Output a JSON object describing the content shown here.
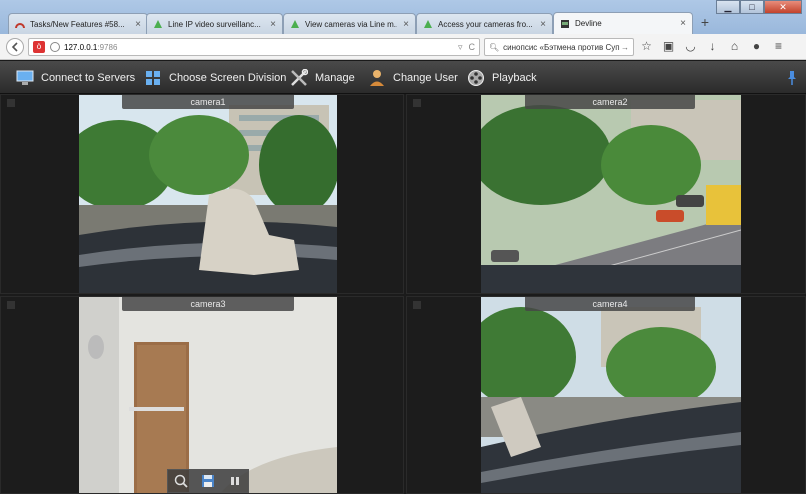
{
  "browser": {
    "tabs": [
      {
        "title": "Tasks/New Features #58...",
        "icon": "redmine-icon",
        "active": false
      },
      {
        "title": "Line IP video surveillanc...",
        "icon": "line-icon",
        "active": false
      },
      {
        "title": "View cameras via Line m...",
        "icon": "line-icon",
        "active": false
      },
      {
        "title": "Access your cameras fro...",
        "icon": "line-icon",
        "active": false
      },
      {
        "title": "Devline",
        "icon": "devline-icon",
        "active": true
      }
    ],
    "tab_close": "×",
    "new_tab": "+",
    "window_buttons": {
      "minimize": "▁",
      "maximize": "□",
      "close": "✕"
    },
    "url_host": "127.0.0.1",
    "url_port": ":9786",
    "search_text": "синопсис «Бэтмена против Суп"
  },
  "toolbar": {
    "items": [
      {
        "label": "Connect to Servers",
        "icon": "monitor-icon"
      },
      {
        "label": "Choose Screen Division",
        "icon": "grid-icon"
      },
      {
        "label": "Manage",
        "icon": "tools-icon"
      },
      {
        "label": "Change User",
        "icon": "user-icon"
      },
      {
        "label": "Playback",
        "icon": "film-reel-icon"
      }
    ]
  },
  "cameras": [
    {
      "label": "camera1"
    },
    {
      "label": "camera2"
    },
    {
      "label": "camera3"
    },
    {
      "label": "camera4"
    }
  ],
  "colors": {
    "toolbar_bg": "#333333",
    "accent_pin": "#4a8de0",
    "label_bg": "#464646"
  }
}
